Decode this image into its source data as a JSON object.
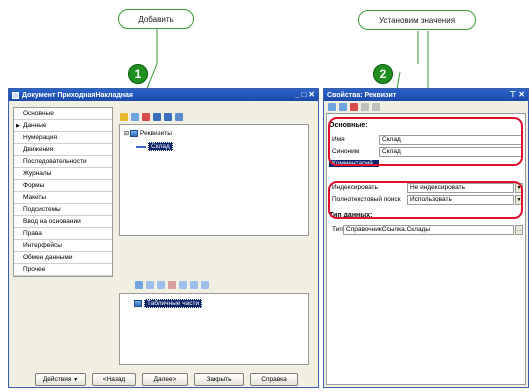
{
  "callouts": {
    "add": "Добавить",
    "set_values": "Установим значения"
  },
  "badges": [
    "1",
    "2"
  ],
  "doc_window": {
    "title": "Документ ПриходнаяНакладная",
    "nav": [
      "Основные",
      "Данные",
      "Нумерация",
      "Движения",
      "Последовательности",
      "Журналы",
      "Формы",
      "Макеты",
      "Подсистемы",
      "Ввод на основании",
      "Права",
      "Интерфейсы",
      "Обмен данными",
      "Прочее"
    ],
    "active_nav": "Данные",
    "tree_root": "Реквизиты",
    "tree_child": "Склад",
    "tab_parts": "Табличные части",
    "buttons": {
      "actions": "Действия",
      "back": "<Назад",
      "next": "Далее>",
      "close": "Закрыть",
      "help": "Справка"
    }
  },
  "props_window": {
    "title": "Свойства: Реквизит",
    "section_main": "Основные:",
    "name_label": "Имя",
    "name_value": "Склад",
    "synonym_label": "Синоним",
    "synonym_value": "Склад",
    "comment_label": "Комментарий",
    "index_label": "Индексировать",
    "index_value": "Не индексировать",
    "fulltext_label": "Полнотекстовый поиск",
    "fulltext_value": "Использовать",
    "section_type": "Тип данных:",
    "type_label": "Тип",
    "type_value": "СправочникСсылка.Склады"
  },
  "colors": {
    "accent_green": "#1f8f1f",
    "highlight_red": "#e0102a",
    "title_blue": "#2c63c8"
  }
}
